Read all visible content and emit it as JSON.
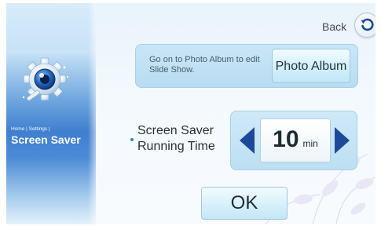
{
  "sidebar": {
    "breadcrumb": "Home | Settings |",
    "title": "Screen Saver"
  },
  "header": {
    "back_label": "Back"
  },
  "photo_album": {
    "message": "Go on to Photo Album to edit Slide Show.",
    "button_label": "Photo Album"
  },
  "setting": {
    "label": "Screen Saver Running Time",
    "value": "10",
    "unit": "min"
  },
  "actions": {
    "ok_label": "OK"
  },
  "colors": {
    "accent": "#1d4a98",
    "sidebar_blue": "#3f7fcf"
  },
  "icons": {
    "settings": "gear-icon",
    "back": "back-arrow-icon",
    "decrease": "arrow-left-icon",
    "increase": "arrow-right-icon"
  }
}
